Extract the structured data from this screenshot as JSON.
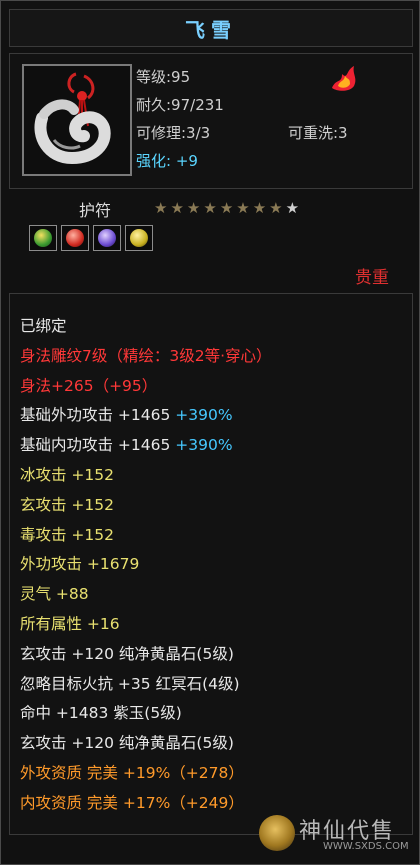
{
  "item": {
    "name": "飞雪",
    "level": "等级:95",
    "durability": "耐久:97/231",
    "repairable": "可修理:3/3",
    "rewashable": "可重洗:3",
    "enhance": "强化: +9",
    "icon": "jade-amulet-icon",
    "corner_icon": "flame-emblem-icon"
  },
  "socket": {
    "label": "护符",
    "stars_total": 9,
    "stars_filled": 8,
    "gems": [
      "green-gem-icon",
      "red-gem-icon",
      "purple-gem-icon",
      "yellow-gem-icon"
    ],
    "rarity": "贵重"
  },
  "attributes": [
    {
      "parts": [
        {
          "text": "已绑定",
          "color": "white"
        }
      ]
    },
    {
      "parts": [
        {
          "text": "身法雕纹7级（精绘：3级2等·穿心）",
          "color": "red"
        }
      ]
    },
    {
      "parts": [
        {
          "text": "身法+265（+95）",
          "color": "red"
        }
      ]
    },
    {
      "parts": [
        {
          "text": "基础外功攻击 +1465 ",
          "color": "white"
        },
        {
          "text": "+390%",
          "color": "cyan"
        }
      ]
    },
    {
      "parts": [
        {
          "text": "基础内功攻击 +1465 ",
          "color": "white"
        },
        {
          "text": "+390%",
          "color": "cyan"
        }
      ]
    },
    {
      "parts": [
        {
          "text": "冰攻击 +152",
          "color": "yellow"
        }
      ]
    },
    {
      "parts": [
        {
          "text": "玄攻击 +152",
          "color": "yellow"
        }
      ]
    },
    {
      "parts": [
        {
          "text": "毒攻击 +152",
          "color": "yellow"
        }
      ]
    },
    {
      "parts": [
        {
          "text": "外功攻击 +1679",
          "color": "yellow"
        }
      ]
    },
    {
      "parts": [
        {
          "text": "灵气 +88",
          "color": "yellow"
        }
      ]
    },
    {
      "parts": [
        {
          "text": "所有属性 +16",
          "color": "yellow"
        }
      ]
    },
    {
      "parts": [
        {
          "text": "玄攻击 +120 纯净黄晶石(5级)",
          "color": "white"
        }
      ]
    },
    {
      "parts": [
        {
          "text": "忽略目标火抗 +35 红冥石(4级)",
          "color": "white"
        }
      ]
    },
    {
      "parts": [
        {
          "text": "命中 +1483 紫玉(5级)",
          "color": "white"
        }
      ]
    },
    {
      "parts": [
        {
          "text": "玄攻击 +120 纯净黄晶石(5级)",
          "color": "white"
        }
      ]
    },
    {
      "parts": [
        {
          "text": "外攻资质  完美 +19%（+278）",
          "color": "orange"
        }
      ]
    },
    {
      "parts": [
        {
          "text": "内攻资质  完美 +17%（+249）",
          "color": "orange"
        }
      ]
    }
  ],
  "watermark": {
    "text": "神仙代售",
    "url": "WWW.SXDS.COM",
    "logo": "coin-logo-icon"
  },
  "colors": {
    "white": "#e8e8e8",
    "red": "#ff3838",
    "yellow": "#e8e070",
    "orange": "#ff9a2a",
    "cyan": "#46c8ff",
    "title": "#7ad0ff"
  }
}
